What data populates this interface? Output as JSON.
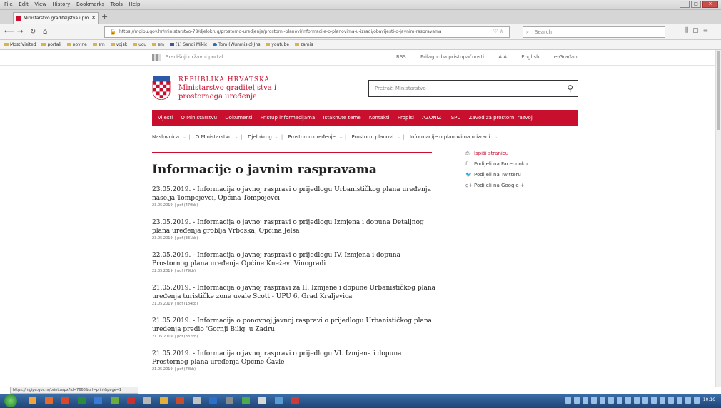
{
  "browser": {
    "menu": [
      "File",
      "Edit",
      "View",
      "History",
      "Bookmarks",
      "Tools",
      "Help"
    ],
    "tab_title": "Ministarstvo graditeljstva i pro",
    "url": "https://mgipu.gov.hr/ministarstvo-78/djelokrug/prostorno-uredjenje/prostorni-planovi/informacije-o-planovima-u-izradi/obavijesti-o-javnim-raspravama",
    "search_placeholder": "Search",
    "bookmarks": [
      "Most Visited",
      "portali",
      "novine",
      "sm",
      "vojsk",
      "ucu",
      "sm",
      "(1) Sandi Mikic",
      "Tom (Wunmisic) Jhs",
      "youtube",
      "zamis"
    ]
  },
  "gov": {
    "portal": "Središnji državni portal",
    "links": [
      "RSS",
      "Prilagodba pristupačnosti",
      "A A",
      "English",
      "e-Građani"
    ]
  },
  "site": {
    "title_line1": "REPUBLIKA HRVATSKA",
    "title_line2": "Ministarstvo graditeljstva i",
    "title_line3": "prostornoga uređenja",
    "search_placeholder": "Pretraži Ministarstvo"
  },
  "mainnav": [
    "Vijesti",
    "O Ministarstvu",
    "Dokumenti",
    "Pristup informacijama",
    "Istaknute teme",
    "Kontakti",
    "Propisi",
    "AZONIZ",
    "ISPU",
    "Zavod za prostorni razvoj"
  ],
  "subnav": [
    "Naslovnica",
    "O Ministarstvu",
    "Djelokrug",
    "Prostorno uređenje",
    "Prostorni planovi",
    "Informacije o planovima u izradi"
  ],
  "heading": "Informacije o javnim raspravama",
  "share": {
    "print": "Ispiši stranicu",
    "facebook": "Podijeli na Facebooku",
    "twitter": "Podijeli na Twitteru",
    "google": "Podijeli na Google +"
  },
  "news": [
    {
      "title": "23.05.2019. - Informacija o javnoj raspravi o prijedlogu Urbanističkog plana uređenja naselja Tompojevci, Općina Tompojevci",
      "meta": "23.05.2019. | pdf (470kb)"
    },
    {
      "title": "23.05.2019. - Informacija o javnoj raspravi o prijedlogu Izmjena i dopuna Detaljnog plana uređenja groblja Vrboska, Općina Jelsa",
      "meta": "23.05.2019. | pdf (331kb)"
    },
    {
      "title": "22.05.2019. - Informacija o javnoj raspravi o prijedlogu IV. Izmjena i dopuna Prostornog plana uređenja Općine Kneževi Vinogradi",
      "meta": "22.05.2019. | pdf (79kb)"
    },
    {
      "title": "21.05.2019. - Informacija o javnoj raspravi za II. Izmjene i dopune Urbanističkog plana uređenja turističke zone uvale Scott - UPU 6, Grad Kraljevica",
      "meta": "21.05.2019. | pdf (184kb)"
    },
    {
      "title": "21.05.2019. - Informacija o ponovnoj javnoj raspravi o prijedlogu Urbanističkog plana uređenja predio 'Gornji Bilig' u Zadru",
      "meta": "21.05.2019. | pdf (387kb)"
    },
    {
      "title": "21.05.2019. - Informacija o javnoj raspravi o prijedlogu VI. Izmjena i dopuna Prostornog plana uređenja Općine Čavle",
      "meta": "21.05.2019. | pdf (78kb)"
    }
  ],
  "status_url": "https://mgipu.gov.hr/print.aspx?id=7666&url=print&page=1",
  "clock": "10:16"
}
